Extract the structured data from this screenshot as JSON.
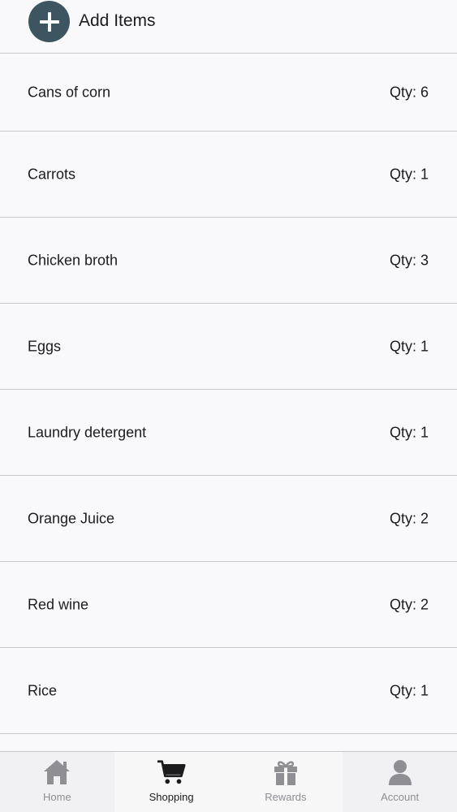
{
  "header": {
    "add_label": "Add Items"
  },
  "items": [
    {
      "name": "Cans of corn",
      "qty": "Qty: 6"
    },
    {
      "name": "Carrots",
      "qty": "Qty: 1"
    },
    {
      "name": "Chicken broth",
      "qty": "Qty: 3"
    },
    {
      "name": "Eggs",
      "qty": "Qty: 1"
    },
    {
      "name": "Laundry detergent",
      "qty": "Qty: 1"
    },
    {
      "name": "Orange Juice",
      "qty": "Qty: 2"
    },
    {
      "name": "Red wine",
      "qty": "Qty: 2"
    },
    {
      "name": "Rice",
      "qty": "Qty: 1"
    }
  ],
  "tabs": [
    {
      "label": "Home",
      "icon": "home-icon"
    },
    {
      "label": "Shopping",
      "icon": "cart-icon"
    },
    {
      "label": "Rewards",
      "icon": "gift-icon"
    },
    {
      "label": "Account",
      "icon": "person-icon"
    }
  ],
  "colors": {
    "accent": "#3c5561",
    "inactive": "#8e8e93",
    "active": "#1c1c1e"
  }
}
